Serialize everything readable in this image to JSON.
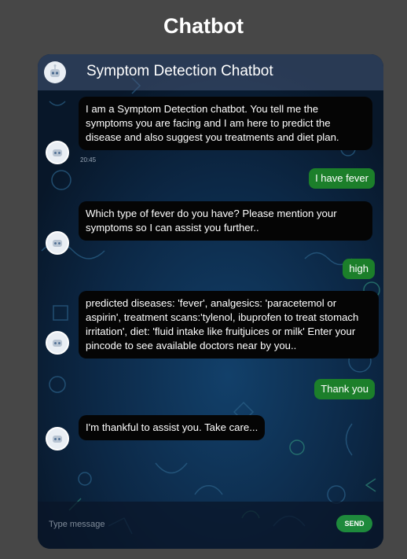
{
  "page": {
    "title": "Chatbot"
  },
  "chat": {
    "header_title": "Symptom Detection Chatbot",
    "messages": [
      {
        "sender": "bot",
        "text": "I am a Symptom Detection chatbot. You tell me the symptoms you are facing and I am here to predict the disease and also suggest you treatments and diet plan.",
        "time": "20:45"
      },
      {
        "sender": "user",
        "text": "I have fever"
      },
      {
        "sender": "bot",
        "text": "Which type of fever do you have? Please mention your symptoms so I can assist you further.."
      },
      {
        "sender": "user",
        "text": "high"
      },
      {
        "sender": "bot",
        "text": "predicted diseases: 'fever', analgesics: 'paracetemol or aspirin', treatment scans:'tylenol, ibuprofen to treat stomach irritation', diet: 'fluid intake like fruitjuices or milk' Enter your pincode to see available doctors near by you.."
      },
      {
        "sender": "user",
        "text": "Thank you"
      },
      {
        "sender": "bot",
        "text": "I'm thankful to assist you. Take care..."
      }
    ]
  },
  "input": {
    "placeholder": "Type message",
    "send_label": "SEND"
  },
  "icons": {
    "avatar": "robot-avatar-icon"
  },
  "colors": {
    "background": "#474747",
    "chat_bg": "#0b1f35",
    "user_bubble": "#1c7f2a",
    "bot_bubble": "#050505",
    "send_button": "#1e8a3c"
  }
}
